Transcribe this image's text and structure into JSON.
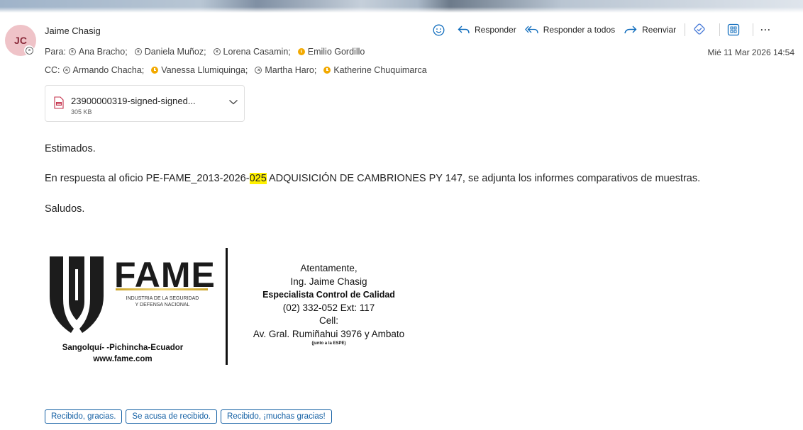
{
  "avatar": {
    "initials": "JC"
  },
  "sender": {
    "name": "Jaime Chasig"
  },
  "to": {
    "label": "Para:",
    "recipients": [
      {
        "name": "Ana Bracho;",
        "status": "offline"
      },
      {
        "name": "Daniela Muñoz;",
        "status": "offline"
      },
      {
        "name": "Lorena Casamin;",
        "status": "offline"
      },
      {
        "name": "Emilio Gordillo",
        "status": "away"
      }
    ]
  },
  "cc": {
    "label": "CC:",
    "recipients": [
      {
        "name": "Armando Chacha;",
        "status": "offline"
      },
      {
        "name": "Vanessa Llumiquinga;",
        "status": "away"
      },
      {
        "name": "Martha Haro;",
        "status": "offline"
      },
      {
        "name": "Katherine Chuquimarca",
        "status": "away"
      }
    ]
  },
  "date": "Mié 11 Mar 2026 14:54",
  "toolbar": {
    "reply": "Responder",
    "reply_all": "Responder a todos",
    "forward": "Reenviar",
    "more": "···"
  },
  "attachment": {
    "name": "23900000319-signed-signed...",
    "size": "305 KB"
  },
  "body": {
    "greeting": "Estimados.",
    "line_prefix": "En respuesta al oficio PE-FAME_2013-2026-",
    "line_highlight": "025",
    "line_suffix": " ADQUISICIÓN DE CAMBRIONES PY 147, se adjunta los informes comparativos de muestras.",
    "closing": "Saludos."
  },
  "signature": {
    "logo_word": "FAME",
    "logo_sub_1": "INDUSTRIA DE LA SEGURIDAD",
    "logo_sub_2": "Y DEFENSA NACIONAL",
    "location": "Sangolquí- -Pichincha-Ecuador",
    "website": "www.fame.com",
    "regards": "Atentamente,",
    "name": "Ing. Jaime Chasig",
    "title": "Especialista Control de Calidad",
    "phone": "(02) 332-052 Ext: 117",
    "cell": "Cell:",
    "address": "Av. Gral. Rumiñahui 3976 y Ambato",
    "address_note": "(junto a la ESPE)"
  },
  "quick_replies": [
    "Recibido, gracias.",
    "Se acusa de recibido.",
    "Recibido, ¡muchas gracias!"
  ],
  "colors": {
    "accent": "#115ea3",
    "highlight": "#fff100",
    "away": "#f2a900",
    "avatar_bg": "#efc3c8"
  }
}
